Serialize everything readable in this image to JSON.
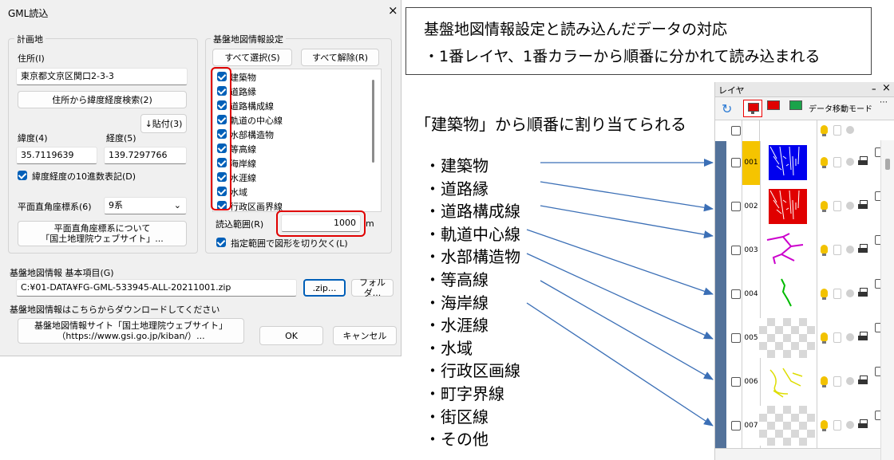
{
  "dialog": {
    "title": "GML読込",
    "close_glyph": "×",
    "plan_group": "計画地",
    "address_label": "住所(I)",
    "address_value": "東京都文京区関口2-3-3",
    "geocode_button": "住所から緯度経度検索(2)",
    "paste_button": "↓貼付(3)",
    "lat_label": "緯度(4)",
    "lat_value": "35.7119639",
    "lon_label": "経度(5)",
    "lon_value": "139.7297766",
    "decimal_label": "緯度経度の10進数表記(D)",
    "plane_label": "平面直角座標系(6)",
    "plane_value": "9系",
    "plane_link_button": "平面直角座標系について\n「国土地理院ウェブサイト」...",
    "basemap_group": "基盤地図情報設定",
    "select_all_button": "すべて選択(S)",
    "deselect_all_button": "すべて解除(R)",
    "basemap_items": [
      "建築物",
      "道路縁",
      "道路構成線",
      "軌道の中心線",
      "水部構造物",
      "等高線",
      "海岸線",
      "水涯線",
      "水域",
      "行政区画界線"
    ],
    "range_label": "読込範囲(R)",
    "range_value": "1000",
    "range_unit": "m",
    "clip_label": "指定範囲で図形を切り欠く(L)",
    "basic_items_label": "基盤地図情報  基本項目(G)",
    "file_path": "C:¥01-DATA¥FG-GML-533945-ALL-20211001.zip",
    "zip_button": ".zip...",
    "folder_button": "フォルダ...",
    "download_label": "基盤地図情報はこちらからダウンロードしてください",
    "gsi_button": "基盤地図情報サイト「国土地理院ウェブサイト」\n（https://www.gsi.go.jp/kiban/）...",
    "ok_button": "OK",
    "cancel_button": "キャンセル"
  },
  "note": {
    "line1": "基盤地図情報設定と読み込んだデータの対応",
    "line2": "・1番レイヤ、1番カラーから順番に分かれて読み込まれる"
  },
  "assign_heading": "「建築物」から順番に割り当てられる",
  "features": [
    "・建築物",
    "・道路縁",
    "・道路構成線",
    "・軌道中心線",
    "・水部構造物",
    "・等高線",
    "・海岸線",
    "・水涯線",
    "・水域",
    "・行政区画線",
    "・町字界線",
    "・街区線",
    "・その他"
  ],
  "layer_panel": {
    "title": "レイヤ",
    "pin_glyph": "ｰ",
    "close_glyph": "×",
    "mode_label": "データ移動モード",
    "more_glyph": "⋯",
    "rows": [
      "001",
      "002",
      "003",
      "004",
      "005",
      "006",
      "007"
    ]
  },
  "colors": {
    "highlight": "#e00000",
    "arrow": "#3b6fb6",
    "layer1": "#f5c400",
    "accent": "#005fb8"
  }
}
